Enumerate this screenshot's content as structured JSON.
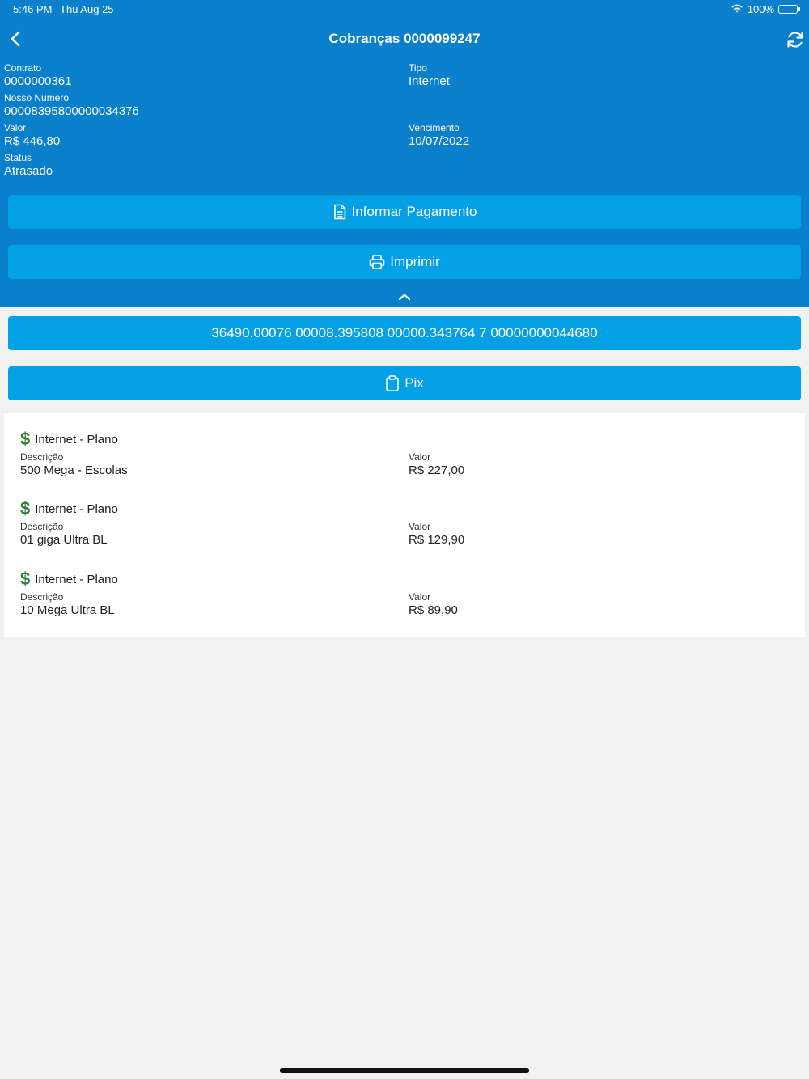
{
  "status_bar": {
    "time": "5:46 PM",
    "date": "Thu Aug 25",
    "battery": "100%"
  },
  "nav": {
    "title": "Cobranças 0000099247"
  },
  "details": {
    "contrato_label": "Contrato",
    "contrato_value": "0000000361",
    "tipo_label": "Tipo",
    "tipo_value": "Internet",
    "nosso_numero_label": "Nosso Numero",
    "nosso_numero_value": "00008395800000034376",
    "valor_label": "Valor",
    "valor_value": "R$ 446,80",
    "vencimento_label": "Vencimento",
    "vencimento_value": "10/07/2022",
    "status_label": "Status",
    "status_value": "Atrasado"
  },
  "actions": {
    "informar_label": "Informar Pagamento",
    "imprimir_label": "Imprimir",
    "barcode_label": "36490.00076 00008.395808 00000.343764 7 00000000044680",
    "pix_label": "Pix"
  },
  "items": [
    {
      "title": "Internet - Plano",
      "desc_label": "Descrição",
      "desc": "500 Mega - Escolas",
      "valor_label": "Valor",
      "valor": "R$ 227,00"
    },
    {
      "title": "Internet - Plano",
      "desc_label": "Descrição",
      "desc": "01 giga Ultra BL",
      "valor_label": "Valor",
      "valor": "R$ 129,90"
    },
    {
      "title": "Internet - Plano",
      "desc_label": "Descrição",
      "desc": "10 Mega Ultra BL",
      "valor_label": "Valor",
      "valor": "R$ 89,90"
    }
  ],
  "icons": {
    "back": "chevron-left-icon",
    "refresh": "refresh-icon",
    "document": "document-icon",
    "printer": "printer-icon",
    "clipboard": "clipboard-icon",
    "dollar": "dollar-icon",
    "collapse": "chevron-up-icon",
    "wifi": "wifi-icon",
    "battery": "battery-icon"
  },
  "colors": {
    "header": "#0a7fcb",
    "button": "#04a0e6",
    "dollar": "#2e7d32",
    "background": "#f1f1f1"
  }
}
